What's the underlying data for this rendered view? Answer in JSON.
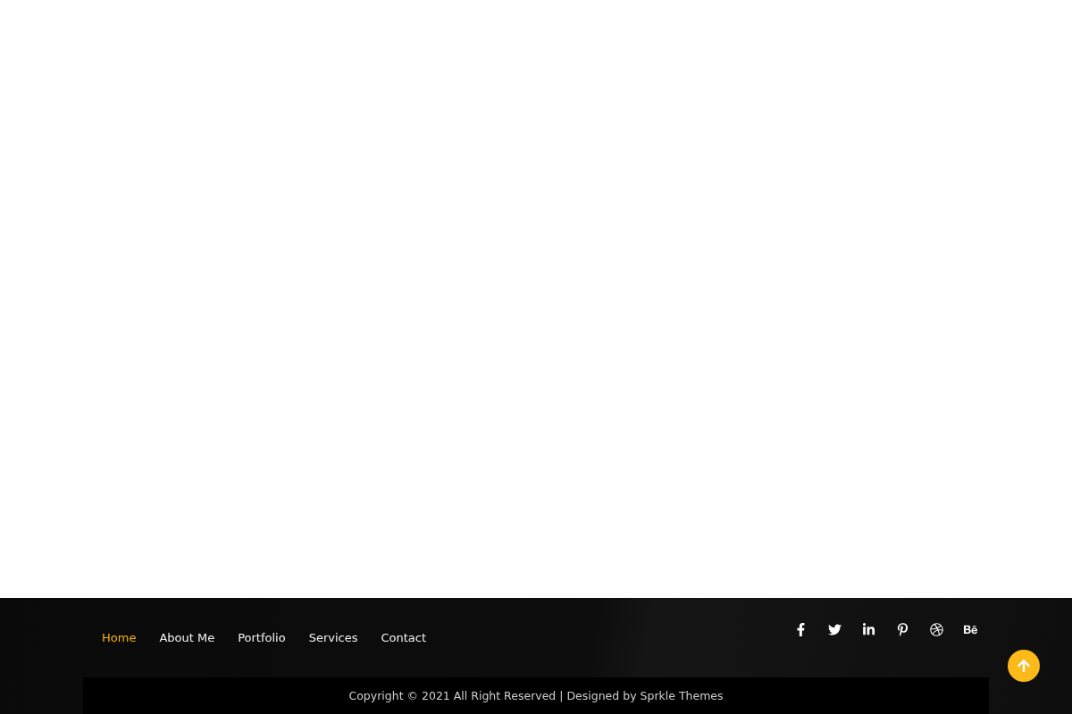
{
  "nav": [
    {
      "label": "Home",
      "selected": true
    },
    {
      "label": "About Me",
      "selected": false
    },
    {
      "label": "Portfolio",
      "selected": false
    },
    {
      "label": "Services",
      "selected": false
    },
    {
      "label": "Contact",
      "selected": false
    }
  ],
  "copyright": "Copyright © 2021 All Right Reserved | Designed by Sprkle Themes"
}
